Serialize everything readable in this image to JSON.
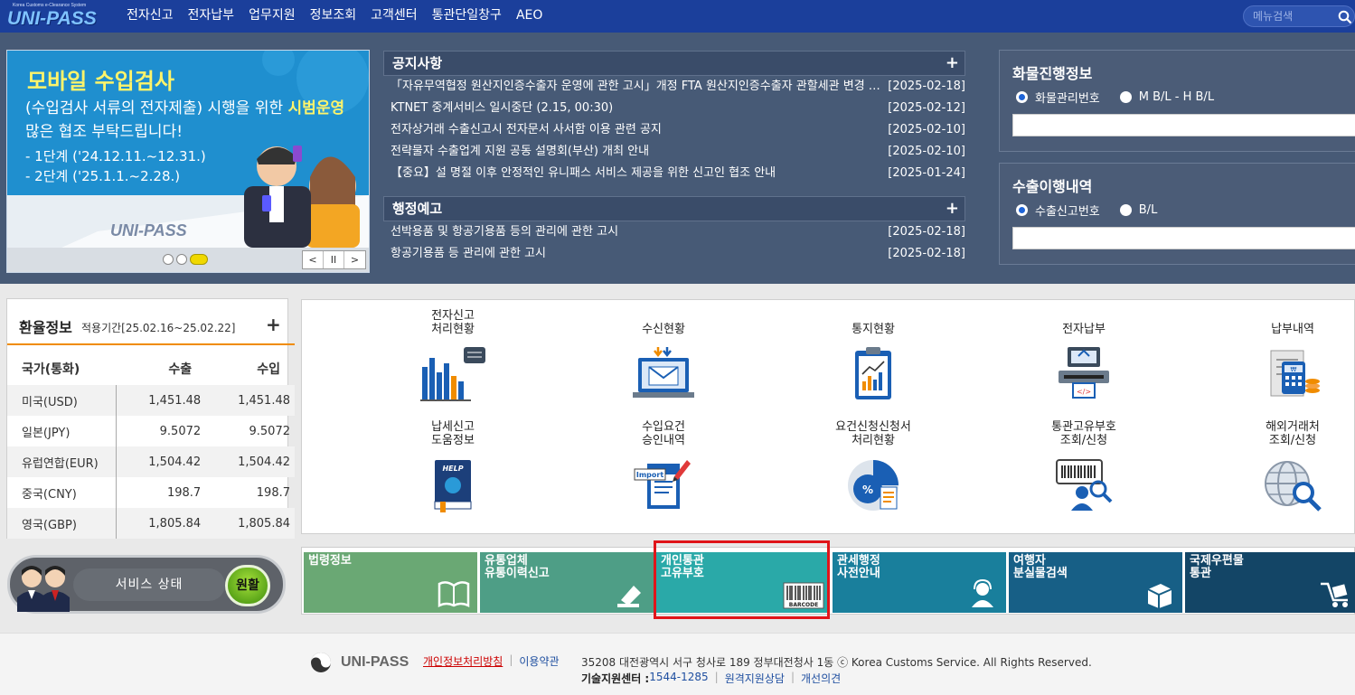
{
  "header": {
    "logo_small": "Korea Customs e-Clearance System",
    "logo": "UNI-PASS",
    "nav": [
      "전자신고",
      "전자납부",
      "업무지원",
      "정보조회",
      "고객센터",
      "통관단일창구",
      "AEO"
    ],
    "search_placeholder": "메뉴검색",
    "search_icon": "search-icon"
  },
  "banner": {
    "title": "모바일 수입검사",
    "line1_a": "(수입검사 서류의 전자제출) 시행을 위한 ",
    "line1_b": "시범운영",
    "line2": "많은 협조 부탁드립니다!",
    "phase1": "- 1단계 ('24.12.11.~12.31.)",
    "phase2": "- 2단계 ('25.1.1.~2.28.)",
    "logo": "UNI-PASS",
    "slide_count": 3,
    "active_slide": 3,
    "controls": [
      "<",
      "II",
      ">"
    ]
  },
  "notices": {
    "title": "공지사항",
    "more": "+",
    "items": [
      {
        "title": "「자유무역협정 원산지인증수출자 운영에 관한 고시」개정 FTA 원산지인증수출자 관할세관 변경 안내",
        "date": "[2025-02-18]"
      },
      {
        "title": "KTNET 중계서비스 일시중단 (2.15, 00:30)",
        "date": "[2025-02-12]"
      },
      {
        "title": "전자상거래 수출신고시 전자문서 사서함 이용 관련 공지",
        "date": "[2025-02-10]"
      },
      {
        "title": "전략물자 수출업계 지원 공동 설명회(부산) 개최 안내",
        "date": "[2025-02-10]"
      },
      {
        "title": "【중요】설 명절 이후 안정적인 유니패스 서비스 제공을 위한 신고인 협조 안내",
        "date": "[2025-01-24]"
      }
    ]
  },
  "admin_notices": {
    "title": "행정예고",
    "more": "+",
    "items": [
      {
        "title": "선박용품 및 항공기용품 등의 관리에 관한 고시",
        "date": "[2025-02-18]"
      },
      {
        "title": "항공기용품 등 관리에 관한 고시",
        "date": "[2025-02-18]"
      }
    ]
  },
  "cargo": {
    "title": "화물진행정보",
    "options": [
      "화물관리번호",
      "M B/L - H B/L"
    ],
    "selected": "화물관리번호"
  },
  "export": {
    "title": "수출이행내역",
    "options": [
      "수출신고번호",
      "B/L"
    ],
    "selected": "수출신고번호"
  },
  "rates": {
    "title": "환율정보",
    "period": "적용기간[25.02.16~25.02.22]",
    "more": "+",
    "headers": [
      "국가(통화)",
      "수출",
      "수입"
    ],
    "rows": [
      [
        "미국(USD)",
        "1,451.48",
        "1,451.48"
      ],
      [
        "일본(JPY)",
        "9.5072",
        "9.5072"
      ],
      [
        "유럽연합(EUR)",
        "1,504.42",
        "1,504.42"
      ],
      [
        "중국(CNY)",
        "198.7",
        "198.7"
      ],
      [
        "영국(GBP)",
        "1,805.84",
        "1,805.84"
      ]
    ]
  },
  "quick": [
    {
      "l1": "전자신고",
      "l2": "처리현황",
      "icon": "bar-chart-icon"
    },
    {
      "l1": "수신현황",
      "l2": "",
      "icon": "mail-laptop-icon"
    },
    {
      "l1": "통지현황",
      "l2": "",
      "icon": "report-clipboard-icon"
    },
    {
      "l1": "전자납부",
      "l2": "",
      "icon": "payment-terminal-icon"
    },
    {
      "l1": "납부내역",
      "l2": "",
      "icon": "receipt-coins-icon"
    },
    {
      "l1": "납세신고",
      "l2": "도움정보",
      "icon": "help-book-icon"
    },
    {
      "l1": "수입요건",
      "l2": "승인내역",
      "icon": "import-document-icon"
    },
    {
      "l1": "요건신청신청서",
      "l2": "처리현황",
      "icon": "percent-pie-icon"
    },
    {
      "l1": "통관고유부호",
      "l2": "조회/신청",
      "icon": "barcode-person-icon"
    },
    {
      "l1": "해외거래처",
      "l2": "조회/신청",
      "icon": "globe-search-icon"
    }
  ],
  "service": {
    "label": "서비스 상태",
    "status": "원활"
  },
  "tiles": [
    {
      "l1": "법령정보",
      "l2": "",
      "color": "#6aa874",
      "icon": "book-icon"
    },
    {
      "l1": "유통업체",
      "l2": "유통이력신고",
      "color": "#4e9e86",
      "icon": "stamp-icon"
    },
    {
      "l1": "개인통관",
      "l2": "고유부호",
      "color": "#2aa9a8",
      "icon": "barcode-icon",
      "badge": "BARCODE"
    },
    {
      "l1": "관세행정",
      "l2": "사전안내",
      "color": "#197f9c",
      "icon": "headset-person-icon"
    },
    {
      "l1": "여행자",
      "l2": "분실물검색",
      "color": "#175f86",
      "icon": "box-icon"
    },
    {
      "l1": "국제우편물",
      "l2": "통관",
      "color": "#134566",
      "icon": "cart-icon"
    }
  ],
  "footer": {
    "logo": "UNI-PASS",
    "privacy": "개인정보처리방침",
    "terms": "이용약관",
    "address": "35208 대전광역시 서구 청사로 189 정부대전청사 1동 ⓒ Korea Customs Service. All Rights Reserved.",
    "tech_label": "기술지원센터 : ",
    "tech_phone": "1544-1285",
    "remote": "원격지원상담",
    "feedback": "개선의견"
  }
}
